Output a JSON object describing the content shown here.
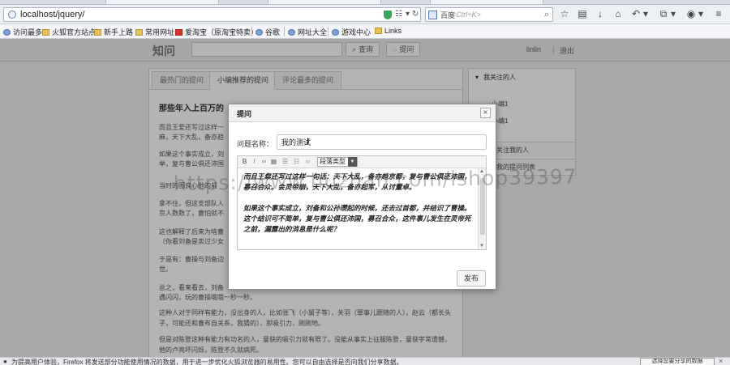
{
  "browser": {
    "url": "localhost/jquery/",
    "search_engine_label": "百度",
    "search_placeholder": "<Ctrl+K>",
    "bookmarks": [
      "访问最多",
      "火狐官方站点",
      "新手上路",
      "常用网址",
      "爱淘宝（原淘宝特卖）",
      "谷歌",
      "网址大全",
      "游戏中心",
      "Links"
    ]
  },
  "site": {
    "logo": "知问",
    "search_button": "查询",
    "ask_button": "提问",
    "username": "linlin",
    "logout": "退出"
  },
  "tabs": [
    "最热门的提问",
    "小编推荐的提问",
    "评论最多的提问"
  ],
  "article": {
    "title": "那些年入上百万的",
    "paragraphs": [
      "而且王爱还写过这样一",
      "麻，天下大乱，备亦趋",
      "如果这个事实成立，刘",
      "举，复与曹公俱还沛国",
      "当时的图良心他的前",
      "拿不住，但这支部队人",
      "京人数数了，曹怕就不",
      "这也解释了后来为啥曹",
      "（你看刘备是卖过少女",
      "于是有：曹操与刘备边",
      "世。",
      "总之，看来看去，刘备",
      "遇闪闪，玩的曹操哦哦一秒一秒。",
      "这种人对于同样有能力，没出身的人，比如张飞（小舅子等），关羽（罪事儿跟随的人），赵云（都长头子，可能还和曹布自关系，我猜的），那吸引力，刚刚地。",
      "但是对陈登这种有能力有功名的人，曼获的吸引力就有限了。没能从事实上征服陈登，曼获宇常遗憾，他的卢亮坏闪烁，陈登不久就病死。"
    ]
  },
  "sidebar": {
    "header": "我关注的人",
    "items": [
      "小编1",
      "小编1"
    ],
    "rows": [
      "关注我的人",
      "我的提问列表"
    ]
  },
  "modal": {
    "title": "提问",
    "close": "×",
    "field_label": "问题名称：",
    "title_value": "我的测试",
    "format_select": "段落类型",
    "toolbar_icons": [
      "B",
      "I",
      "∞",
      "▦",
      "☰",
      "☷",
      "‹›"
    ],
    "body_paragraphs": [
      "而且王粲还写过这样一句话：天下大乱，备亦趋京都，复与曹公俱还沛国，募召合众。会灵帝崩，天下大乱，备亦起军，从讨董卓。",
      "如果这个事实成立，刘备和公孙瓒起的时候，还去过首都，并结识了曹操。这个结识可不简单，复与曹公俱还沛国，募召合众，这件事儿发生在灵帝死之前，漏露出的消息是什么呢？"
    ],
    "publish_button": "发布"
  },
  "watermark": "https://www.huzhan.com/ishop39397",
  "notification": {
    "message": "为提高用户体验，Firefox 将发送部分功能使用情况的数据，用于进一步优化火狐浏览器的易用性。您可以自由选择是否向我们分享数据。",
    "button": "选择您要分享的数据"
  }
}
